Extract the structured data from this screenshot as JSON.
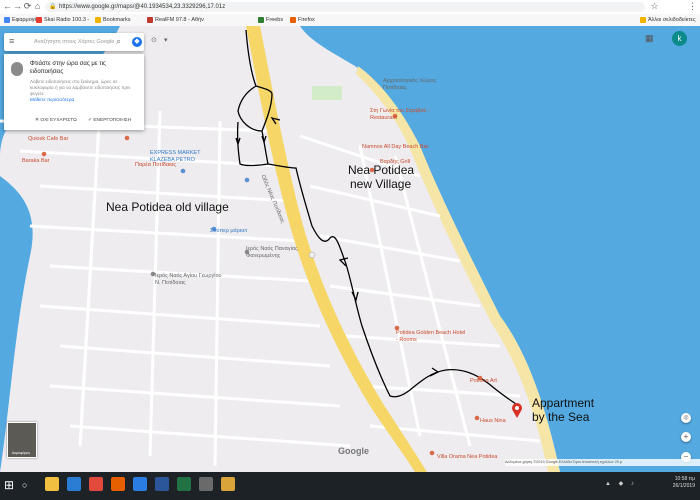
{
  "browser": {
    "nav_back": "←",
    "nav_forward": "→",
    "nav_reload": "⟳",
    "nav_home": "⌂",
    "url": "https://www.google.gr/maps/@40.1934534,23.3329296,17.01z",
    "secure_icon": "lock-icon",
    "star_icon": "☆",
    "bookmarks": [
      {
        "label": "Εφαρμογές",
        "color": "#4285f4"
      },
      {
        "label": "Skai Radio 100.3 -",
        "color": "#e63b2e"
      },
      {
        "label": "Bookmarks",
        "color": "#f0b400"
      },
      {
        "label": "RealFM 97.8 - Αθήν",
        "color": "#c0392b"
      },
      {
        "label": "Freebs",
        "color": "#2e7d32"
      },
      {
        "label": "Firefox",
        "color": "#e66000"
      },
      {
        "label": "Άλλοι σελιδοδείκτες",
        "color": "#f0b400"
      }
    ]
  },
  "search": {
    "placeholder": "Αναζήτηση στους Χάρτες Google",
    "menu_icon": "≡",
    "search_icon": "⌕",
    "directions_icon": "◆"
  },
  "popup": {
    "title": "Φτιάστε στην ώρα σας με τις ειδοποιήσεις",
    "body": "Λάβετε ειδοποιήσεις στο ξεκίνημα, ώρες σε κυκλοφορία ή για να λαμβάνετε ειδοποιήσεις πριν φύγετε.",
    "link": "Μάθετε περισσότερα",
    "no_thanks": "ΟΧΙ ΕΥΧΑΡΙΣΤΩ",
    "enable": "ΕΝΕΡΓΟΠΟΙΗΣΗ"
  },
  "account": {
    "initial": "k",
    "apps_icon": "▦"
  },
  "map": {
    "place_labels": [
      {
        "text": "Αρχαιολογικός Χώρος Ποτίδαιας",
        "cls": "gray"
      },
      {
        "text": "Στη Γωνία του Στραβού - Restaurant",
        "cls": "red"
      },
      {
        "text": "Namnos All Day Beach Bar",
        "cls": "red"
      },
      {
        "text": "Βαρδής Grill",
        "cls": "red"
      },
      {
        "text": "Quiosk Cafe Bar",
        "cls": "red"
      },
      {
        "text": "Baraka Bar",
        "cls": "red"
      },
      {
        "text": "EXPRESS MARKET KLAZEBA PETRO",
        "cls": "blue"
      },
      {
        "text": "Παρέα Ποτίδαιας",
        "cls": "red"
      },
      {
        "text": "Ιερός Ναός Παναγίας Φανερωμένης",
        "cls": "gray"
      },
      {
        "text": "Σούπερ μάρκετ",
        "cls": "blue"
      },
      {
        "text": "Ιερός Ναός Αγίου Γεωργίου Ν. Ποτίδαιας",
        "cls": "gray"
      },
      {
        "text": "Potidea Golden Beach Hotel - Rooms",
        "cls": "red"
      },
      {
        "text": "Potidea Art",
        "cls": "red"
      },
      {
        "text": "Villa Orama Nea Potidea",
        "cls": "red"
      },
      {
        "text": "Haus Nina",
        "cls": "red"
      },
      {
        "text": "Οδός Νέας Ποτίδαιας",
        "cls": "gray"
      }
    ],
    "annotations": {
      "old_village": "Nea Potidea old village",
      "new_village_line1": "Nea Potidea",
      "new_village_line2": "new Village",
      "appartment_line1": "Appartment",
      "appartment_line2": "by the Sea"
    },
    "road_number": "Ε",
    "google_logo": "Google",
    "attribution": "Δεδομένα χάρτη ©2019 Google   Ελλάδα   Όροι   Αποστολή σχολίων   20 μ",
    "layer_label": "Δορυφόρος",
    "zoom_in": "+",
    "zoom_out": "−",
    "colors": {
      "sea": "#53a9e0",
      "beach": "#f5e6a8",
      "land": "#eeecef",
      "road_main": "#f5d667",
      "route": "#000000",
      "pin": "#d93025"
    }
  },
  "taskbar": {
    "start_icon": "⊞",
    "search_icon": "○",
    "time": "10:58 πμ",
    "date": "26/1/2019",
    "apps": [
      {
        "name": "file-explorer",
        "color": "#f0c040"
      },
      {
        "name": "edge",
        "color": "#2b7cd3"
      },
      {
        "name": "chrome",
        "color": "#e24a3b"
      },
      {
        "name": "firefox",
        "color": "#e66000"
      },
      {
        "name": "mail",
        "color": "#2a7de1"
      },
      {
        "name": "word",
        "color": "#2b579a"
      },
      {
        "name": "excel",
        "color": "#217346"
      },
      {
        "name": "store",
        "color": "#6a6a6a"
      },
      {
        "name": "paint",
        "color": "#d9a53b"
      }
    ]
  }
}
